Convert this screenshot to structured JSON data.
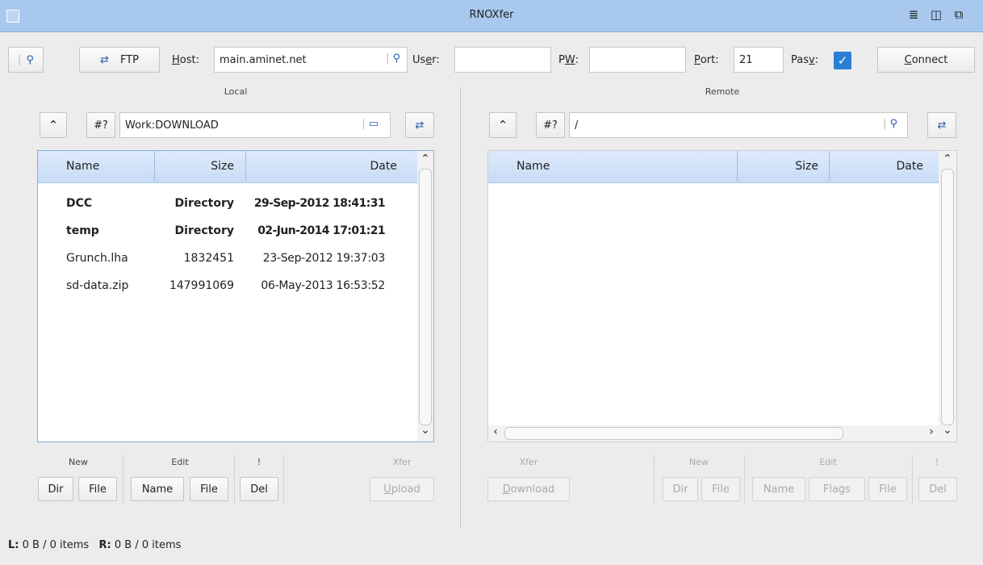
{
  "window": {
    "title": "RNOXfer"
  },
  "toolbar": {
    "protocol_label": "FTP",
    "host_label": "Host:",
    "host_value": "main.aminet.net",
    "user_label": "User:",
    "user_value": "",
    "pw_label": "PW:",
    "pw_value": "",
    "port_label": "Port:",
    "port_value": "21",
    "pasv_label": "Pasv:",
    "pasv_checked": true,
    "connect_label": "Connect"
  },
  "local": {
    "section_label": "Local",
    "up_label": "^",
    "hash_label": "#?",
    "path": "Work:DOWNLOAD",
    "columns": [
      "Name",
      "Size",
      "Date"
    ],
    "rows": [
      {
        "name": "DCC",
        "size": "Directory",
        "date": "29-Sep-2012 18:41:31",
        "bold": true
      },
      {
        "name": "temp",
        "size": "Directory",
        "date": "02-Jun-2014 17:01:21",
        "bold": true
      },
      {
        "name": "Grunch.lha",
        "size": "1832451",
        "date": "23-Sep-2012 19:37:03",
        "bold": false
      },
      {
        "name": "sd-data.zip",
        "size": "147991069",
        "date": "06-May-2013 16:53:52",
        "bold": false
      }
    ],
    "groups": {
      "new": "New",
      "edit": "Edit",
      "bang": "!",
      "xfer": "Xfer"
    },
    "buttons": {
      "dir": "Dir",
      "file": "File",
      "name": "Name",
      "edit_file": "File",
      "del": "Del",
      "upload": "Upload"
    }
  },
  "remote": {
    "section_label": "Remote",
    "up_label": "^",
    "hash_label": "#?",
    "path": "/",
    "columns": [
      "Name",
      "Size",
      "Date"
    ],
    "rows": [],
    "groups": {
      "xfer": "Xfer",
      "new": "New",
      "edit": "Edit",
      "bang": "!"
    },
    "buttons": {
      "download": "Download",
      "dir": "Dir",
      "file": "File",
      "name": "Name",
      "flags": "Flags",
      "edit_file": "File",
      "del": "Del"
    }
  },
  "status": {
    "left_label": "L:",
    "left_value": "0 B / 0 items",
    "right_label": "R:",
    "right_value": "0 B / 0 items"
  },
  "colors": {
    "titlebar": "#a8c8ee",
    "header": "#c8dcf6",
    "accent": "#2a7fd4"
  }
}
